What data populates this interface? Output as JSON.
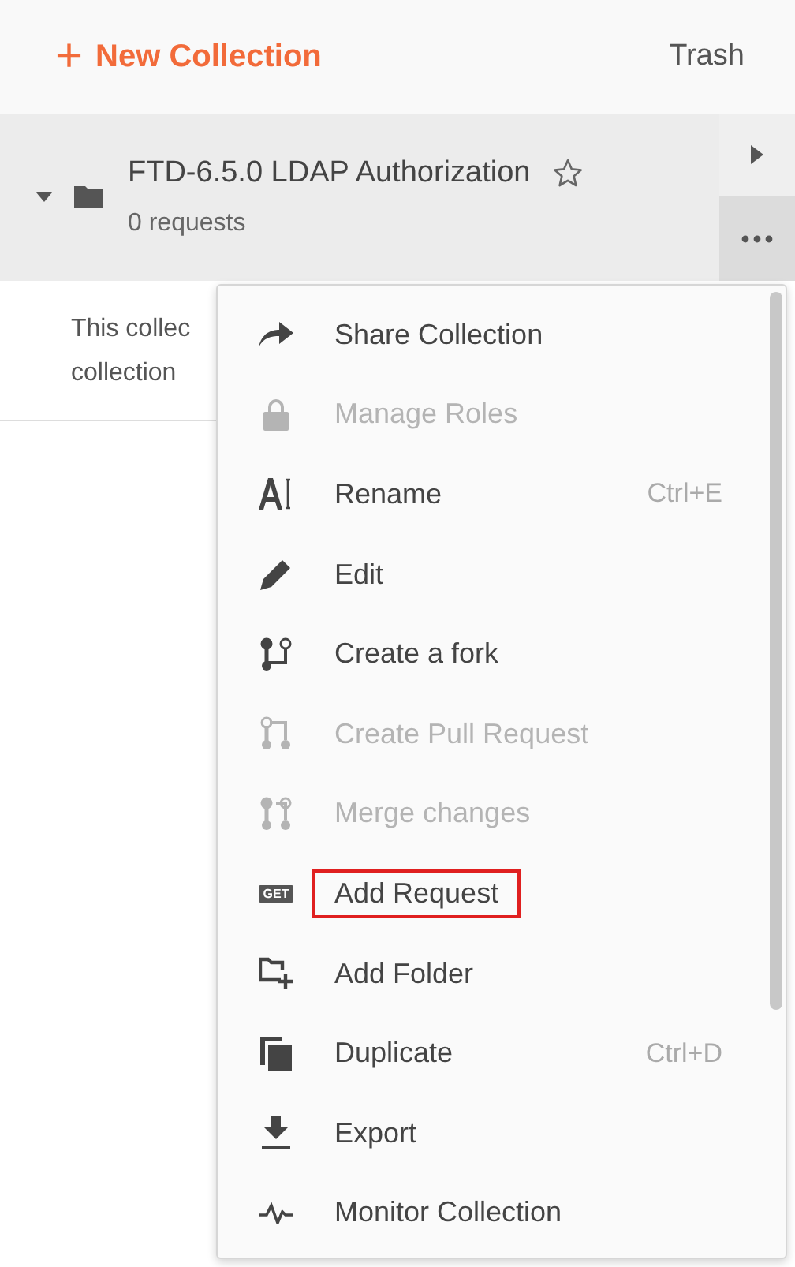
{
  "header": {
    "new_button": {
      "icon": "+",
      "label": "New Collection"
    },
    "trash_link": "Trash"
  },
  "collection": {
    "name": "FTD-6.5.0 LDAP Authorization",
    "count": "0 requests",
    "expanded": true,
    "starred": false,
    "description_lines": [
      "This collec",
      "collection"
    ]
  },
  "menu": {
    "items": [
      {
        "label": "Share Collection",
        "disabled": false,
        "highlighted": false
      },
      {
        "label": "Manage Roles",
        "disabled": true,
        "highlighted": false
      },
      {
        "label": "Rename",
        "shortcut": "Ctrl+E",
        "disabled": false,
        "highlighted": false
      },
      {
        "label": "Edit",
        "disabled": false,
        "highlighted": false
      },
      {
        "label": "Create a fork",
        "disabled": false,
        "highlighted": false
      },
      {
        "label": "Create Pull Request",
        "disabled": true,
        "highlighted": false
      },
      {
        "label": "Merge changes",
        "disabled": true,
        "highlighted": false
      },
      {
        "label": "Add Request",
        "icon_text": "GET",
        "disabled": false,
        "highlighted": true
      },
      {
        "label": "Add Folder",
        "disabled": false,
        "highlighted": false
      },
      {
        "label": "Duplicate",
        "shortcut": "Ctrl+D",
        "disabled": false,
        "highlighted": false
      },
      {
        "label": "Export",
        "disabled": false,
        "highlighted": false
      },
      {
        "label": "Monitor Collection",
        "disabled": false,
        "highlighted": false
      }
    ]
  }
}
